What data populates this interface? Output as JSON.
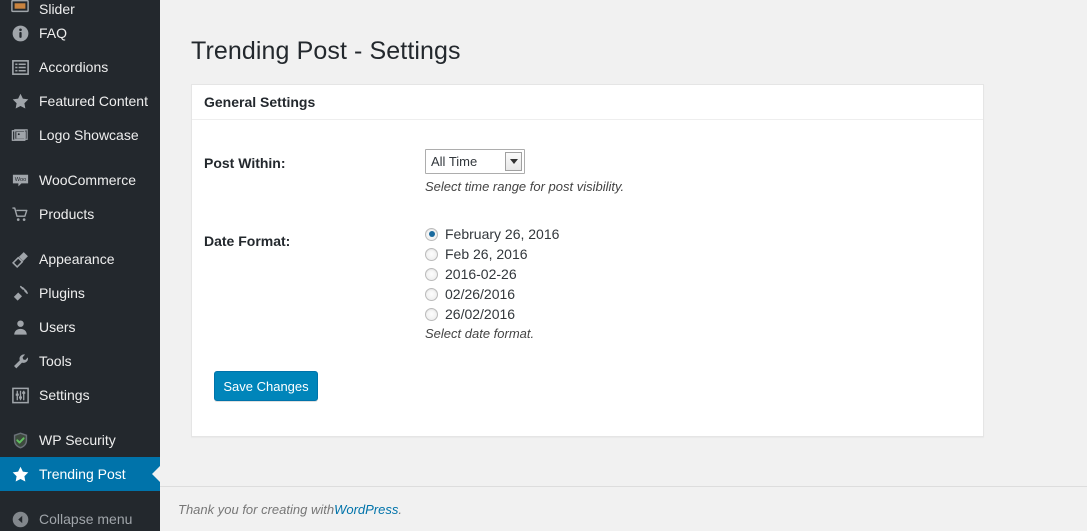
{
  "sidebar": {
    "background_color": "#23282d",
    "active_color": "#0073aa",
    "clipped_top_item": {
      "label": "Slider",
      "icon": "slider-icon"
    },
    "items": [
      {
        "label": "FAQ",
        "icon": "info-icon",
        "active": false,
        "dim": false
      },
      {
        "label": "Accordions",
        "icon": "list-icon",
        "active": false,
        "dim": false
      },
      {
        "label": "Featured Content",
        "icon": "star-icon",
        "active": false,
        "dim": false
      },
      {
        "label": "Logo Showcase",
        "icon": "images-stack-icon",
        "active": false,
        "dim": false
      },
      {
        "label": "WooCommerce",
        "icon": "woocommerce-icon",
        "active": false,
        "dim": false
      },
      {
        "label": "Products",
        "icon": "cart-icon",
        "active": false,
        "dim": false
      },
      {
        "label": "Appearance",
        "icon": "paintbrush-icon",
        "active": false,
        "dim": false
      },
      {
        "label": "Plugins",
        "icon": "plug-icon",
        "active": false,
        "dim": false
      },
      {
        "label": "Users",
        "icon": "user-icon",
        "active": false,
        "dim": false
      },
      {
        "label": "Tools",
        "icon": "wrench-icon",
        "active": false,
        "dim": false
      },
      {
        "label": "Settings",
        "icon": "sliders-icon",
        "active": false,
        "dim": false
      },
      {
        "label": "WP Security",
        "icon": "shield-check-icon",
        "active": false,
        "dim": false
      },
      {
        "label": "Trending Post",
        "icon": "star-icon",
        "active": true,
        "dim": false
      },
      {
        "label": "Collapse menu",
        "icon": "collapse-arrow-icon",
        "active": false,
        "dim": true
      }
    ]
  },
  "page": {
    "title": "Trending Post - Settings"
  },
  "panel": {
    "header": "General Settings",
    "post_within": {
      "label": "Post Within:",
      "selected_value": "All Time",
      "helper": "Select time range for post visibility."
    },
    "date_format": {
      "label": "Date Format:",
      "helper": "Select date format.",
      "options": [
        {
          "label": "February 26, 2016",
          "checked": true
        },
        {
          "label": "Feb 26, 2016",
          "checked": false
        },
        {
          "label": "2016-02-26",
          "checked": false
        },
        {
          "label": "02/26/2016",
          "checked": false
        },
        {
          "label": "26/02/2016",
          "checked": false
        }
      ]
    },
    "save_label": "Save Changes"
  },
  "footer": {
    "text": "Thank you for creating with ",
    "link": "WordPress",
    "suffix": "."
  }
}
